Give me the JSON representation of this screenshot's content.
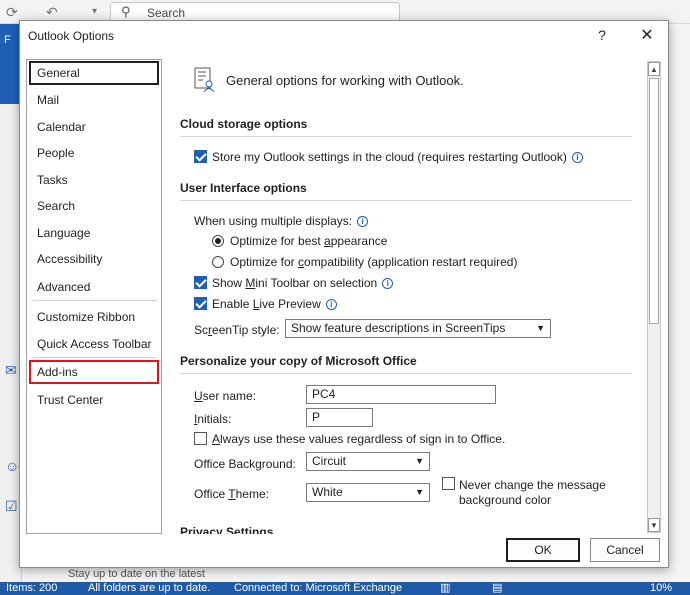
{
  "background": {
    "search_placeholder": "Search",
    "status_items": "Items: 200",
    "status_sync": "All folders are up to date.",
    "status_connection": "Connected to: Microsoft Exchange",
    "status_zoom": "10%",
    "peek_text": "Stay up to date on the latest"
  },
  "dialog": {
    "title": "Outlook Options",
    "help_label": "?",
    "close_label": "✕"
  },
  "sidebar": {
    "items": [
      {
        "label": "General"
      },
      {
        "label": "Mail"
      },
      {
        "label": "Calendar"
      },
      {
        "label": "People"
      },
      {
        "label": "Tasks"
      },
      {
        "label": "Search"
      },
      {
        "label": "Language"
      },
      {
        "label": "Accessibility"
      },
      {
        "label": "Advanced"
      },
      {
        "label": "Customize Ribbon"
      },
      {
        "label": "Quick Access Toolbar"
      },
      {
        "label": "Add-ins"
      },
      {
        "label": "Trust Center"
      }
    ]
  },
  "content": {
    "header": "General options for working with Outlook.",
    "cloud": {
      "heading": "Cloud storage options",
      "store_settings": "Store my Outlook settings in the cloud (requires restarting Outlook)",
      "store_settings_checked": true
    },
    "ui": {
      "heading": "User Interface options",
      "multi_display_label": "When using multiple displays:",
      "opt_best_pre": "Optimize for best ",
      "opt_best_u": "a",
      "opt_best_post": "ppearance",
      "opt_compat_pre": "Optimize for ",
      "opt_compat_u": "c",
      "opt_compat_post": "ompatibility (application restart required)",
      "mini_toolbar_pre": "Show ",
      "mini_toolbar_u": "M",
      "mini_toolbar_post": "ini Toolbar on selection",
      "mini_toolbar_checked": true,
      "live_preview_pre": "Enable ",
      "live_preview_u": "L",
      "live_preview_post": "ive Preview",
      "live_preview_checked": true,
      "screentip_label_pre": "Sc",
      "screentip_label_u": "r",
      "screentip_label_post": "eenTip style:",
      "screentip_value": "Show feature descriptions in ScreenTips"
    },
    "personalize": {
      "heading": "Personalize your copy of Microsoft Office",
      "username_label_u": "U",
      "username_label_post": "ser name:",
      "username_value": "PC4",
      "initials_label_u": "I",
      "initials_label_post": "nitials:",
      "initials_value": "P",
      "always_use_u": "A",
      "always_use_post": "lways use these values regardless of sign in to Office.",
      "always_use_checked": false,
      "background_label": "Office Background:",
      "background_value": "Circuit",
      "theme_label_pre": "Office ",
      "theme_label_u": "T",
      "theme_label_post": "heme:",
      "theme_value": "White",
      "never_change_line1": "Never change the message",
      "never_change_line2": "background color",
      "never_change_checked": false
    },
    "privacy_heading": "Privacy Settings"
  },
  "footer": {
    "ok_label": "OK",
    "cancel_label": "Cancel"
  },
  "colors": {
    "accent": "#1f5fb4",
    "highlight_border": "#e0131d"
  }
}
